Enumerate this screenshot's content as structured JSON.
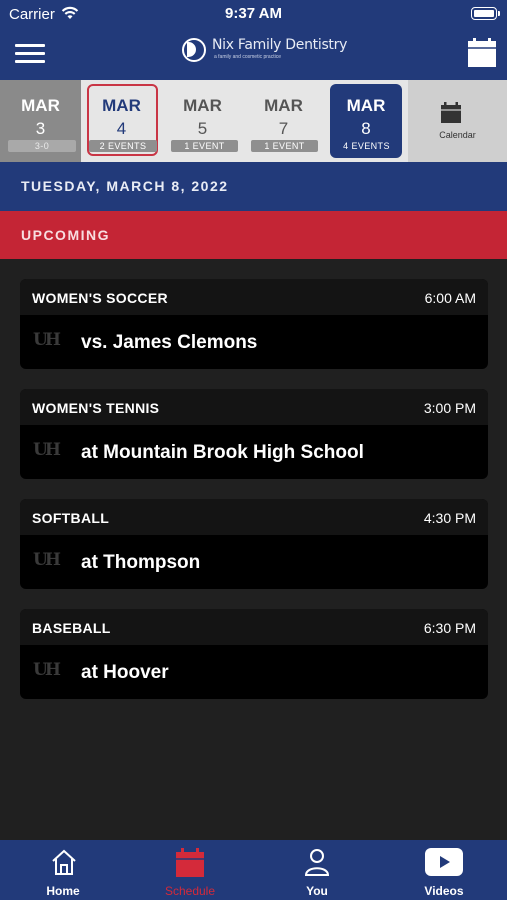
{
  "status": {
    "carrier": "Carrier",
    "time": "9:37 AM"
  },
  "header": {
    "logo_name": "Nix Family Dentistry",
    "logo_tagline": "a family and cosmetic practice"
  },
  "date_strip": [
    {
      "month": "MAR",
      "day": "3",
      "badge": "3-0",
      "state": "past"
    },
    {
      "month": "MAR",
      "day": "4",
      "badge": "2 EVENTS",
      "state": "today"
    },
    {
      "month": "MAR",
      "day": "5",
      "badge": "1 EVENT",
      "state": "normal"
    },
    {
      "month": "MAR",
      "day": "7",
      "badge": "1 EVENT",
      "state": "normal"
    },
    {
      "month": "MAR",
      "day": "8",
      "badge": "4 EVENTS",
      "state": "selected"
    }
  ],
  "calendar_label": "Calendar",
  "selected_date": "TUESDAY, MARCH 8, 2022",
  "section_label": "UPCOMING",
  "events": [
    {
      "sport": "WOMEN'S SOCCER",
      "time": "6:00 AM",
      "opponent": "vs. James Clemons",
      "logo": "UH"
    },
    {
      "sport": "WOMEN'S TENNIS",
      "time": "3:00 PM",
      "opponent": "at Mountain Brook High School",
      "logo": "UH"
    },
    {
      "sport": "SOFTBALL",
      "time": "4:30 PM",
      "opponent": "at Thompson",
      "logo": "UH"
    },
    {
      "sport": "BASEBALL",
      "time": "6:30 PM",
      "opponent": "at Hoover",
      "logo": "UH"
    }
  ],
  "tabs": [
    {
      "label": "Home",
      "icon": "home-icon",
      "active": false
    },
    {
      "label": "Schedule",
      "icon": "calendar-icon",
      "active": true
    },
    {
      "label": "You",
      "icon": "person-icon",
      "active": false
    },
    {
      "label": "Videos",
      "icon": "play-icon",
      "active": false
    }
  ],
  "colors": {
    "navy": "#223a7a",
    "red": "#c42535",
    "active_tab": "#d42a3a",
    "background": "#202020"
  }
}
